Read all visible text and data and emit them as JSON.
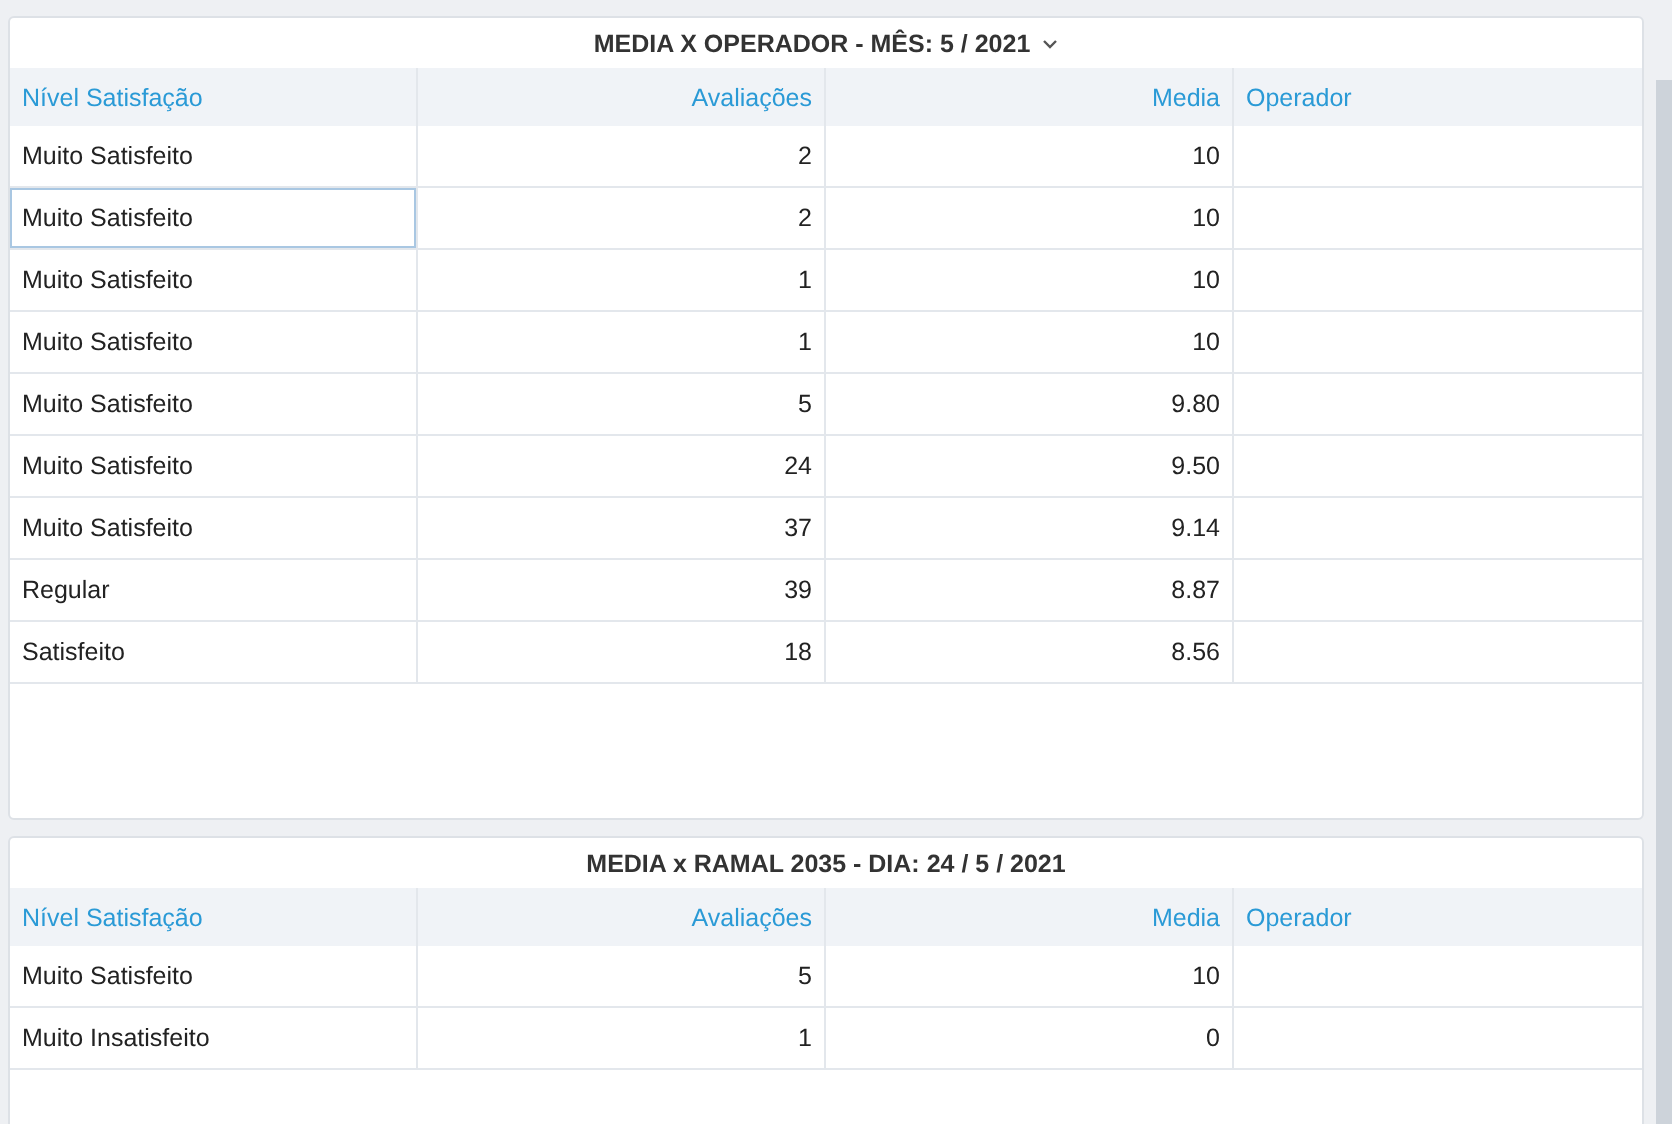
{
  "panels": [
    {
      "title": "MEDIA X OPERADOR - MÊS: 5 / 2021",
      "has_menu": true,
      "columns": [
        "Nível Satisfação",
        "Avaliações",
        "Media",
        "Operador"
      ],
      "rows": [
        {
          "cells": [
            "Muito Satisfeito",
            "2",
            "10"
          ],
          "focused": false
        },
        {
          "cells": [
            "Muito Satisfeito",
            "2",
            "10"
          ],
          "focused": true
        },
        {
          "cells": [
            "Muito Satisfeito",
            "1",
            "10"
          ],
          "focused": false
        },
        {
          "cells": [
            "Muito Satisfeito",
            "1",
            "10"
          ],
          "focused": false
        },
        {
          "cells": [
            "Muito Satisfeito",
            "5",
            "9.80"
          ],
          "focused": false
        },
        {
          "cells": [
            "Muito Satisfeito",
            "24",
            "9.50"
          ],
          "focused": false
        },
        {
          "cells": [
            "Muito Satisfeito",
            "37",
            "9.14"
          ],
          "focused": false
        },
        {
          "cells": [
            "Regular",
            "39",
            "8.87"
          ],
          "focused": false
        },
        {
          "cells": [
            "Satisfeito",
            "18",
            "8.56"
          ],
          "focused": false
        }
      ]
    },
    {
      "title": "MEDIA x RAMAL 2035 - DIA: 24 / 5 / 2021",
      "has_menu": false,
      "columns": [
        "Nível Satisfação",
        "Avaliações",
        "Media",
        "Operador"
      ],
      "rows": [
        {
          "cells": [
            "Muito Satisfeito",
            "5",
            "10"
          ],
          "focused": false
        },
        {
          "cells": [
            "Muito Insatisfeito",
            "1",
            "0"
          ],
          "focused": false
        }
      ]
    }
  ]
}
